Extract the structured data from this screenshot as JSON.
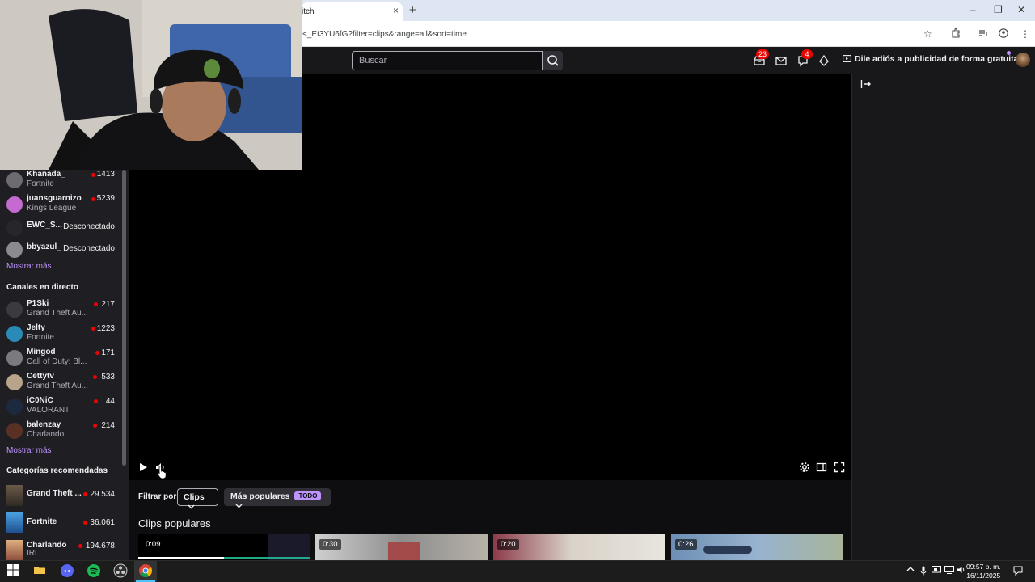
{
  "browser": {
    "tab_title": "itch",
    "tab_close": "×",
    "new_tab": "+",
    "url": "<_Et3YU6fG?filter=clips&range=all&sort=time",
    "window_controls": [
      "–",
      "❐",
      "✕"
    ]
  },
  "twitch_nav": {
    "search_placeholder": "Buscar",
    "notifications_count": "23",
    "activity_count": "4",
    "ad_free_label": "Dile adiós a publicidad de forma gratuita"
  },
  "sidebar": {
    "followed": [
      {
        "name": "Khanada_",
        "game": "Fortnite",
        "viewers": "1413",
        "live": true
      },
      {
        "name": "juansguarnizo",
        "game": "Kings League",
        "viewers": "5239",
        "live": true
      },
      {
        "name": "EWC_S...",
        "game": "",
        "status": "Desconectado",
        "live": false
      },
      {
        "name": "bbyazul_",
        "game": "",
        "status": "Desconectado",
        "live": false
      }
    ],
    "show_more_1": "Mostrar más",
    "live_heading": "Canales en directo",
    "live_channels": [
      {
        "name": "P1Ski",
        "game": "Grand Theft Au...",
        "viewers": "217"
      },
      {
        "name": "Jelty",
        "game": "Fortnite",
        "viewers": "1223"
      },
      {
        "name": "Mingod",
        "game": "Call of Duty: Bl...",
        "viewers": "171"
      },
      {
        "name": "Cettytv",
        "game": "Grand Theft Au...",
        "viewers": "533"
      },
      {
        "name": "iC0NiC",
        "game": "VALORANT",
        "viewers": "44"
      },
      {
        "name": "balenzay",
        "game": "Charlando",
        "viewers": "214"
      }
    ],
    "show_more_2": "Mostrar más",
    "categories_heading": "Categorías recomendadas",
    "categories": [
      {
        "name": "Grand Theft ...",
        "sub": "",
        "viewers": "29.534"
      },
      {
        "name": "Fortnite",
        "sub": "",
        "viewers": "36.061"
      },
      {
        "name": "Charlando",
        "sub": "IRL",
        "viewers": "194.678"
      }
    ]
  },
  "clips": {
    "filter_label": "Filtrar por",
    "filter_value": "Clips",
    "sort_value": "Más populares",
    "range_badge": "TODO",
    "heading": "Clips populares",
    "items": [
      {
        "duration": "0:09"
      },
      {
        "duration": "0:30"
      },
      {
        "duration": "0:20"
      },
      {
        "duration": "0:26"
      }
    ]
  },
  "taskbar": {
    "time": "09:57 p. m.",
    "date": "16/11/2025"
  },
  "colors": {
    "twitch_purple": "#bf94ff",
    "live_red": "#eb0400",
    "background": "#0e0e10"
  }
}
